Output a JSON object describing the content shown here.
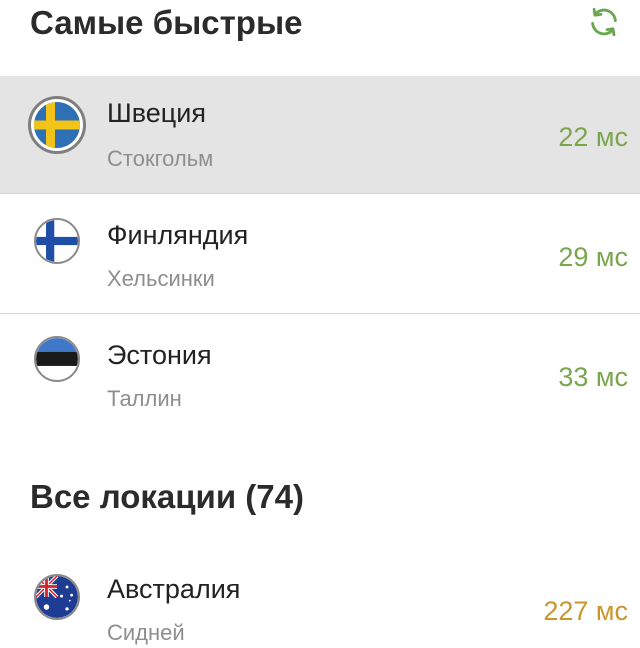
{
  "fastest_section": {
    "title": "Самые быстрые",
    "refresh_icon": "refresh-icon",
    "accent_color": "#6aa84f"
  },
  "fastest_servers": [
    {
      "country": "Швеция",
      "city": "Стокгольм",
      "ping": "22 мс",
      "flag_icon": "sweden-flag-icon",
      "ping_color": "#7aa64e",
      "selected": true
    },
    {
      "country": "Финляндия",
      "city": "Хельсинки",
      "ping": "29 мс",
      "flag_icon": "finland-flag-icon",
      "ping_color": "#7aa64e",
      "selected": false
    },
    {
      "country": "Эстония",
      "city": "Таллин",
      "ping": "33 мс",
      "flag_icon": "estonia-flag-icon",
      "ping_color": "#7aa64e",
      "selected": false
    }
  ],
  "all_section": {
    "title": "Все локации (74)"
  },
  "all_servers": [
    {
      "country": "Австралия",
      "city": "Сидней",
      "ping": "227 мс",
      "flag_icon": "australia-flag-icon",
      "ping_color": "#c9962e",
      "selected": false
    }
  ]
}
